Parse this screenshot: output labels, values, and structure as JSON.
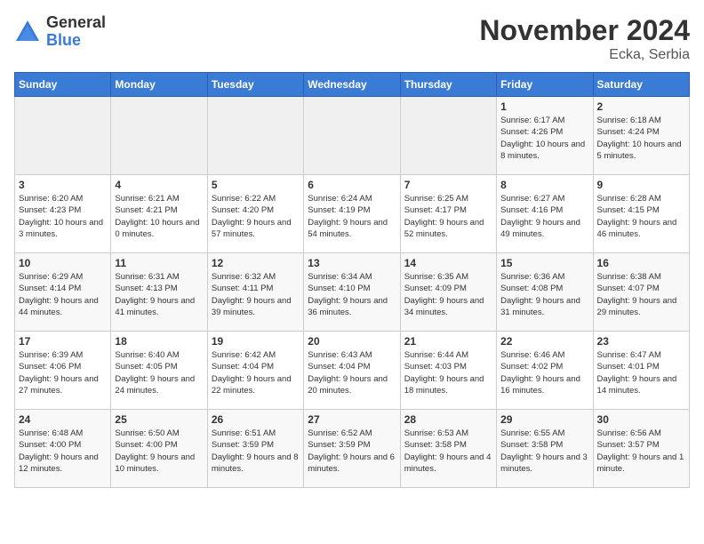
{
  "header": {
    "logo_line1": "General",
    "logo_line2": "Blue",
    "title": "November 2024",
    "subtitle": "Ecka, Serbia"
  },
  "weekdays": [
    "Sunday",
    "Monday",
    "Tuesday",
    "Wednesday",
    "Thursday",
    "Friday",
    "Saturday"
  ],
  "weeks": [
    [
      {
        "day": "",
        "info": ""
      },
      {
        "day": "",
        "info": ""
      },
      {
        "day": "",
        "info": ""
      },
      {
        "day": "",
        "info": ""
      },
      {
        "day": "",
        "info": ""
      },
      {
        "day": "1",
        "info": "Sunrise: 6:17 AM\nSunset: 4:26 PM\nDaylight: 10 hours and 8 minutes."
      },
      {
        "day": "2",
        "info": "Sunrise: 6:18 AM\nSunset: 4:24 PM\nDaylight: 10 hours and 5 minutes."
      }
    ],
    [
      {
        "day": "3",
        "info": "Sunrise: 6:20 AM\nSunset: 4:23 PM\nDaylight: 10 hours and 3 minutes."
      },
      {
        "day": "4",
        "info": "Sunrise: 6:21 AM\nSunset: 4:21 PM\nDaylight: 10 hours and 0 minutes."
      },
      {
        "day": "5",
        "info": "Sunrise: 6:22 AM\nSunset: 4:20 PM\nDaylight: 9 hours and 57 minutes."
      },
      {
        "day": "6",
        "info": "Sunrise: 6:24 AM\nSunset: 4:19 PM\nDaylight: 9 hours and 54 minutes."
      },
      {
        "day": "7",
        "info": "Sunrise: 6:25 AM\nSunset: 4:17 PM\nDaylight: 9 hours and 52 minutes."
      },
      {
        "day": "8",
        "info": "Sunrise: 6:27 AM\nSunset: 4:16 PM\nDaylight: 9 hours and 49 minutes."
      },
      {
        "day": "9",
        "info": "Sunrise: 6:28 AM\nSunset: 4:15 PM\nDaylight: 9 hours and 46 minutes."
      }
    ],
    [
      {
        "day": "10",
        "info": "Sunrise: 6:29 AM\nSunset: 4:14 PM\nDaylight: 9 hours and 44 minutes."
      },
      {
        "day": "11",
        "info": "Sunrise: 6:31 AM\nSunset: 4:13 PM\nDaylight: 9 hours and 41 minutes."
      },
      {
        "day": "12",
        "info": "Sunrise: 6:32 AM\nSunset: 4:11 PM\nDaylight: 9 hours and 39 minutes."
      },
      {
        "day": "13",
        "info": "Sunrise: 6:34 AM\nSunset: 4:10 PM\nDaylight: 9 hours and 36 minutes."
      },
      {
        "day": "14",
        "info": "Sunrise: 6:35 AM\nSunset: 4:09 PM\nDaylight: 9 hours and 34 minutes."
      },
      {
        "day": "15",
        "info": "Sunrise: 6:36 AM\nSunset: 4:08 PM\nDaylight: 9 hours and 31 minutes."
      },
      {
        "day": "16",
        "info": "Sunrise: 6:38 AM\nSunset: 4:07 PM\nDaylight: 9 hours and 29 minutes."
      }
    ],
    [
      {
        "day": "17",
        "info": "Sunrise: 6:39 AM\nSunset: 4:06 PM\nDaylight: 9 hours and 27 minutes."
      },
      {
        "day": "18",
        "info": "Sunrise: 6:40 AM\nSunset: 4:05 PM\nDaylight: 9 hours and 24 minutes."
      },
      {
        "day": "19",
        "info": "Sunrise: 6:42 AM\nSunset: 4:04 PM\nDaylight: 9 hours and 22 minutes."
      },
      {
        "day": "20",
        "info": "Sunrise: 6:43 AM\nSunset: 4:04 PM\nDaylight: 9 hours and 20 minutes."
      },
      {
        "day": "21",
        "info": "Sunrise: 6:44 AM\nSunset: 4:03 PM\nDaylight: 9 hours and 18 minutes."
      },
      {
        "day": "22",
        "info": "Sunrise: 6:46 AM\nSunset: 4:02 PM\nDaylight: 9 hours and 16 minutes."
      },
      {
        "day": "23",
        "info": "Sunrise: 6:47 AM\nSunset: 4:01 PM\nDaylight: 9 hours and 14 minutes."
      }
    ],
    [
      {
        "day": "24",
        "info": "Sunrise: 6:48 AM\nSunset: 4:00 PM\nDaylight: 9 hours and 12 minutes."
      },
      {
        "day": "25",
        "info": "Sunrise: 6:50 AM\nSunset: 4:00 PM\nDaylight: 9 hours and 10 minutes."
      },
      {
        "day": "26",
        "info": "Sunrise: 6:51 AM\nSunset: 3:59 PM\nDaylight: 9 hours and 8 minutes."
      },
      {
        "day": "27",
        "info": "Sunrise: 6:52 AM\nSunset: 3:59 PM\nDaylight: 9 hours and 6 minutes."
      },
      {
        "day": "28",
        "info": "Sunrise: 6:53 AM\nSunset: 3:58 PM\nDaylight: 9 hours and 4 minutes."
      },
      {
        "day": "29",
        "info": "Sunrise: 6:55 AM\nSunset: 3:58 PM\nDaylight: 9 hours and 3 minutes."
      },
      {
        "day": "30",
        "info": "Sunrise: 6:56 AM\nSunset: 3:57 PM\nDaylight: 9 hours and 1 minute."
      }
    ]
  ]
}
